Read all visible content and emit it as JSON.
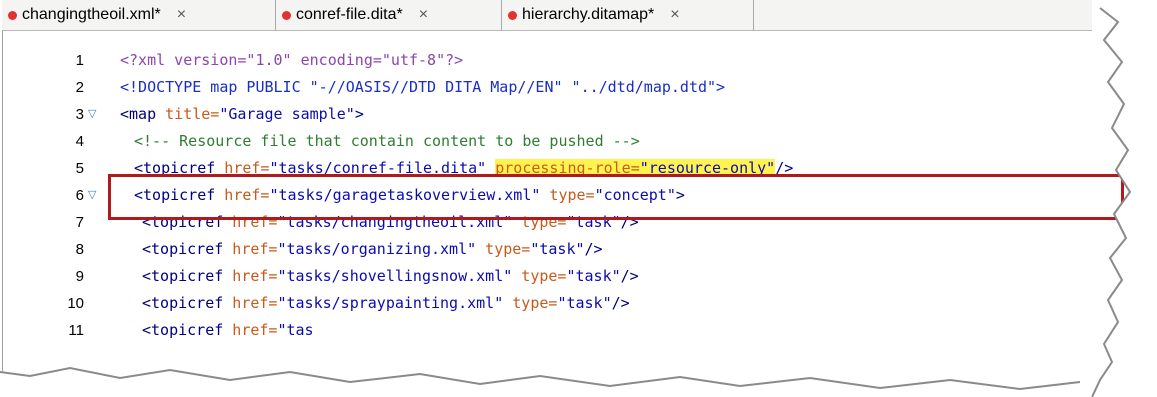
{
  "tabs": [
    {
      "label": "changingtheoil.xml*",
      "close": "×"
    },
    {
      "label": "conref-file.dita*",
      "close": "×"
    },
    {
      "label": "hierarchy.ditamap*",
      "close": "×"
    }
  ],
  "lines": [
    {
      "num": "1",
      "segments": [
        {
          "t": "<?xml version=\"1.0\" encoding=\"utf-8\"?>",
          "c": "decl"
        }
      ]
    },
    {
      "num": "2",
      "segments": [
        {
          "t": "<!DOCTYPE map PUBLIC \"-//OASIS//DTD DITA Map//EN\" \"../dtd/map.dtd\">",
          "c": "blue"
        }
      ]
    },
    {
      "num": "3",
      "fold": true,
      "segments": [
        {
          "t": "<map",
          "c": "tag"
        },
        {
          "t": " title=",
          "c": "attr"
        },
        {
          "t": "\"Garage sample\"",
          "c": "val"
        },
        {
          "t": ">",
          "c": "tag"
        }
      ]
    },
    {
      "num": "4",
      "segments": [
        {
          "t": "<!-- Resource file that contain content to be pushed -->",
          "c": "comment"
        }
      ]
    },
    {
      "num": "5",
      "segments": [
        {
          "t": "<topicref",
          "c": "tag"
        },
        {
          "t": " href=",
          "c": "attr"
        },
        {
          "t": "\"tasks/conref-file.dita\"",
          "c": "val"
        },
        {
          "t": " ",
          "c": "tag"
        },
        {
          "t": "processing-role=",
          "c": "attr hl"
        },
        {
          "t": "\"resource-only\"",
          "c": "val hl"
        },
        {
          "t": "/>",
          "c": "tag"
        }
      ]
    },
    {
      "num": "6",
      "fold": true,
      "segments": [
        {
          "t": "<topicref",
          "c": "tag"
        },
        {
          "t": " href=",
          "c": "attr"
        },
        {
          "t": "\"tasks/garagetaskoverview.xml\"",
          "c": "val"
        },
        {
          "t": " type=",
          "c": "attr"
        },
        {
          "t": "\"concept\"",
          "c": "val"
        },
        {
          "t": ">",
          "c": "tag"
        }
      ]
    },
    {
      "num": "7",
      "segments": [
        {
          "t": "<topicref",
          "c": "tag"
        },
        {
          "t": " href=",
          "c": "attr"
        },
        {
          "t": "\"tasks/changingtheoil.xml\"",
          "c": "val"
        },
        {
          "t": " type=",
          "c": "attr"
        },
        {
          "t": "\"task\"",
          "c": "val"
        },
        {
          "t": "/>",
          "c": "tag"
        }
      ]
    },
    {
      "num": "8",
      "segments": [
        {
          "t": "<topicref",
          "c": "tag"
        },
        {
          "t": " href=",
          "c": "attr"
        },
        {
          "t": "\"tasks/organizing.xml\"",
          "c": "val"
        },
        {
          "t": " type=",
          "c": "attr"
        },
        {
          "t": "\"task\"",
          "c": "val"
        },
        {
          "t": "/>",
          "c": "tag"
        }
      ]
    },
    {
      "num": "9",
      "segments": [
        {
          "t": "<topicref",
          "c": "tag"
        },
        {
          "t": " href=",
          "c": "attr"
        },
        {
          "t": "\"tasks/shovellingsnow.xml\"",
          "c": "val"
        },
        {
          "t": " type=",
          "c": "attr"
        },
        {
          "t": "\"task\"",
          "c": "val"
        },
        {
          "t": "/>",
          "c": "tag"
        }
      ]
    },
    {
      "num": "10",
      "segments": [
        {
          "t": "<topicref",
          "c": "tag"
        },
        {
          "t": " href=",
          "c": "attr"
        },
        {
          "t": "\"tasks/spraypainting.xml\"",
          "c": "val"
        },
        {
          "t": " type=",
          "c": "attr"
        },
        {
          "t": "\"task\"",
          "c": "val"
        },
        {
          "t": "/>",
          "c": "tag"
        }
      ]
    },
    {
      "num": "11",
      "segments": [
        {
          "t": "<topicref",
          "c": "tag"
        },
        {
          "t": " href=",
          "c": "attr"
        },
        {
          "t": "\"tas",
          "c": "val"
        }
      ]
    }
  ]
}
